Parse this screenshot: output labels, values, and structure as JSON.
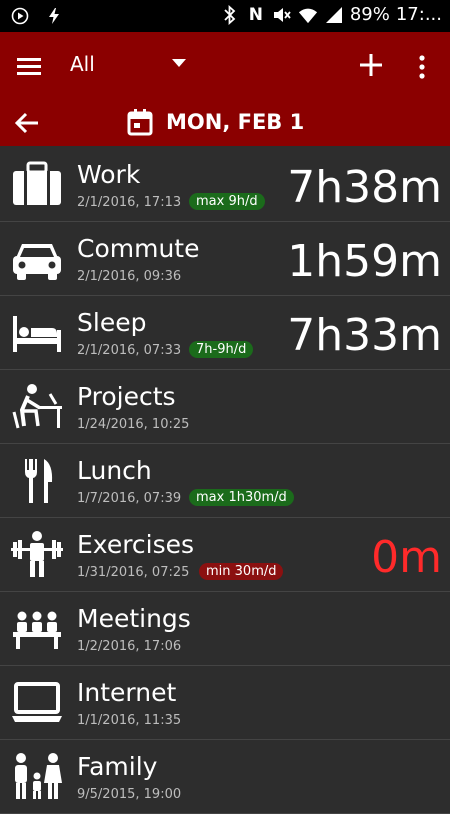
{
  "status_bar": {
    "battery": "89%",
    "time": "17:..."
  },
  "toolbar": {
    "filter": "All"
  },
  "date_bar": {
    "date": "MON, FEB 1"
  },
  "activities": [
    {
      "name": "Work",
      "timestamp": "2/1/2016, 17:13",
      "badge": "max 9h/d",
      "badge_color": "green",
      "duration": "7h38m",
      "duration_color": "white",
      "icon": "briefcase-icon"
    },
    {
      "name": "Commute",
      "timestamp": "2/1/2016, 09:36",
      "badge": "",
      "duration": "1h59m",
      "duration_color": "white",
      "icon": "car-icon"
    },
    {
      "name": "Sleep",
      "timestamp": "2/1/2016, 07:33",
      "badge": "7h-9h/d",
      "badge_color": "green",
      "duration": "7h33m",
      "duration_color": "white",
      "icon": "bed-icon"
    },
    {
      "name": "Projects",
      "timestamp": "1/24/2016, 10:25",
      "badge": "",
      "duration": "",
      "icon": "person-at-desk-icon"
    },
    {
      "name": "Lunch",
      "timestamp": "1/7/2016, 07:39",
      "badge": "max 1h30m/d",
      "badge_color": "green",
      "duration": "",
      "icon": "fork-knife-icon"
    },
    {
      "name": "Exercises",
      "timestamp": "1/31/2016, 07:25",
      "badge": "min 30m/d",
      "badge_color": "red",
      "duration": "0m",
      "duration_color": "red",
      "icon": "weightlifting-icon"
    },
    {
      "name": "Meetings",
      "timestamp": "1/2/2016, 17:06",
      "badge": "",
      "duration": "",
      "icon": "meeting-icon"
    },
    {
      "name": "Internet",
      "timestamp": "1/1/2016, 11:35",
      "badge": "",
      "duration": "",
      "icon": "laptop-icon"
    },
    {
      "name": "Family",
      "timestamp": "9/5/2015, 19:00",
      "badge": "",
      "duration": "",
      "icon": "family-icon"
    }
  ],
  "colors": {
    "header": "#8b0000",
    "background": "#2d2d2d",
    "badge_green": "#1b6b1b",
    "badge_red": "#8b1010",
    "alert_red": "#ff2a2a"
  }
}
